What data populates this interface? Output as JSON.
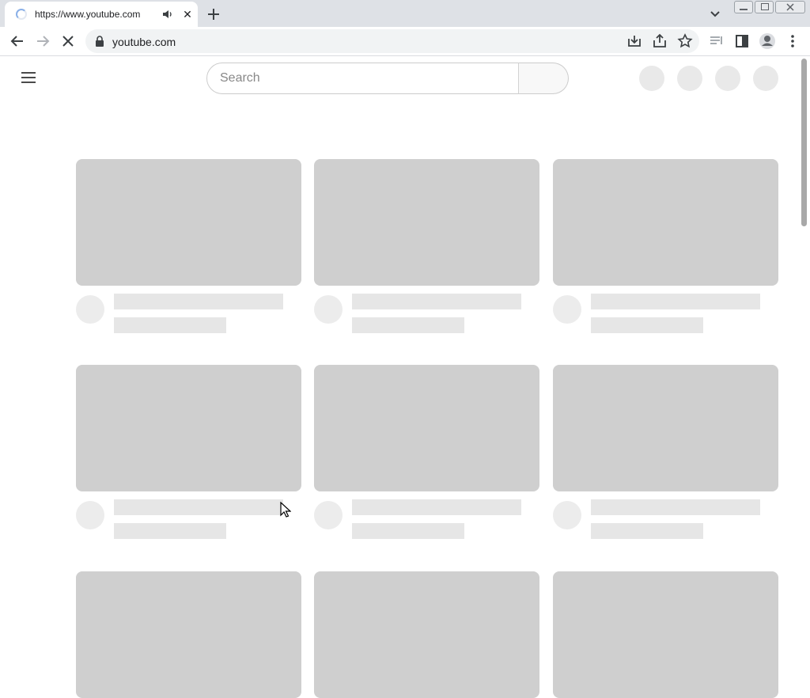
{
  "browser": {
    "tab": {
      "title": "https://www.youtube.com",
      "close_glyph": "✕"
    },
    "address": {
      "url": "youtube.com"
    },
    "icons": [
      "loading-spinner-icon",
      "audio-playing-icon",
      "close-icon",
      "new-tab-icon",
      "tab-search-icon",
      "minimize-icon",
      "restore-icon",
      "close-window-icon",
      "back-icon",
      "forward-icon",
      "stop-loading-icon",
      "lock-icon",
      "install-icon",
      "share-icon",
      "bookmark-star-icon",
      "media-icon",
      "side-panel-icon",
      "profile-icon",
      "more-menu-icon"
    ]
  },
  "youtube": {
    "search": {
      "placeholder": "Search"
    },
    "icons": [
      "menu-icon",
      "search-icon"
    ]
  },
  "colors": {
    "tabstrip": "#dee1e6",
    "skeleton_thumb": "#cfcfcf",
    "skeleton_text": "#e6e6e6",
    "skeleton_avatar": "#ececec"
  }
}
